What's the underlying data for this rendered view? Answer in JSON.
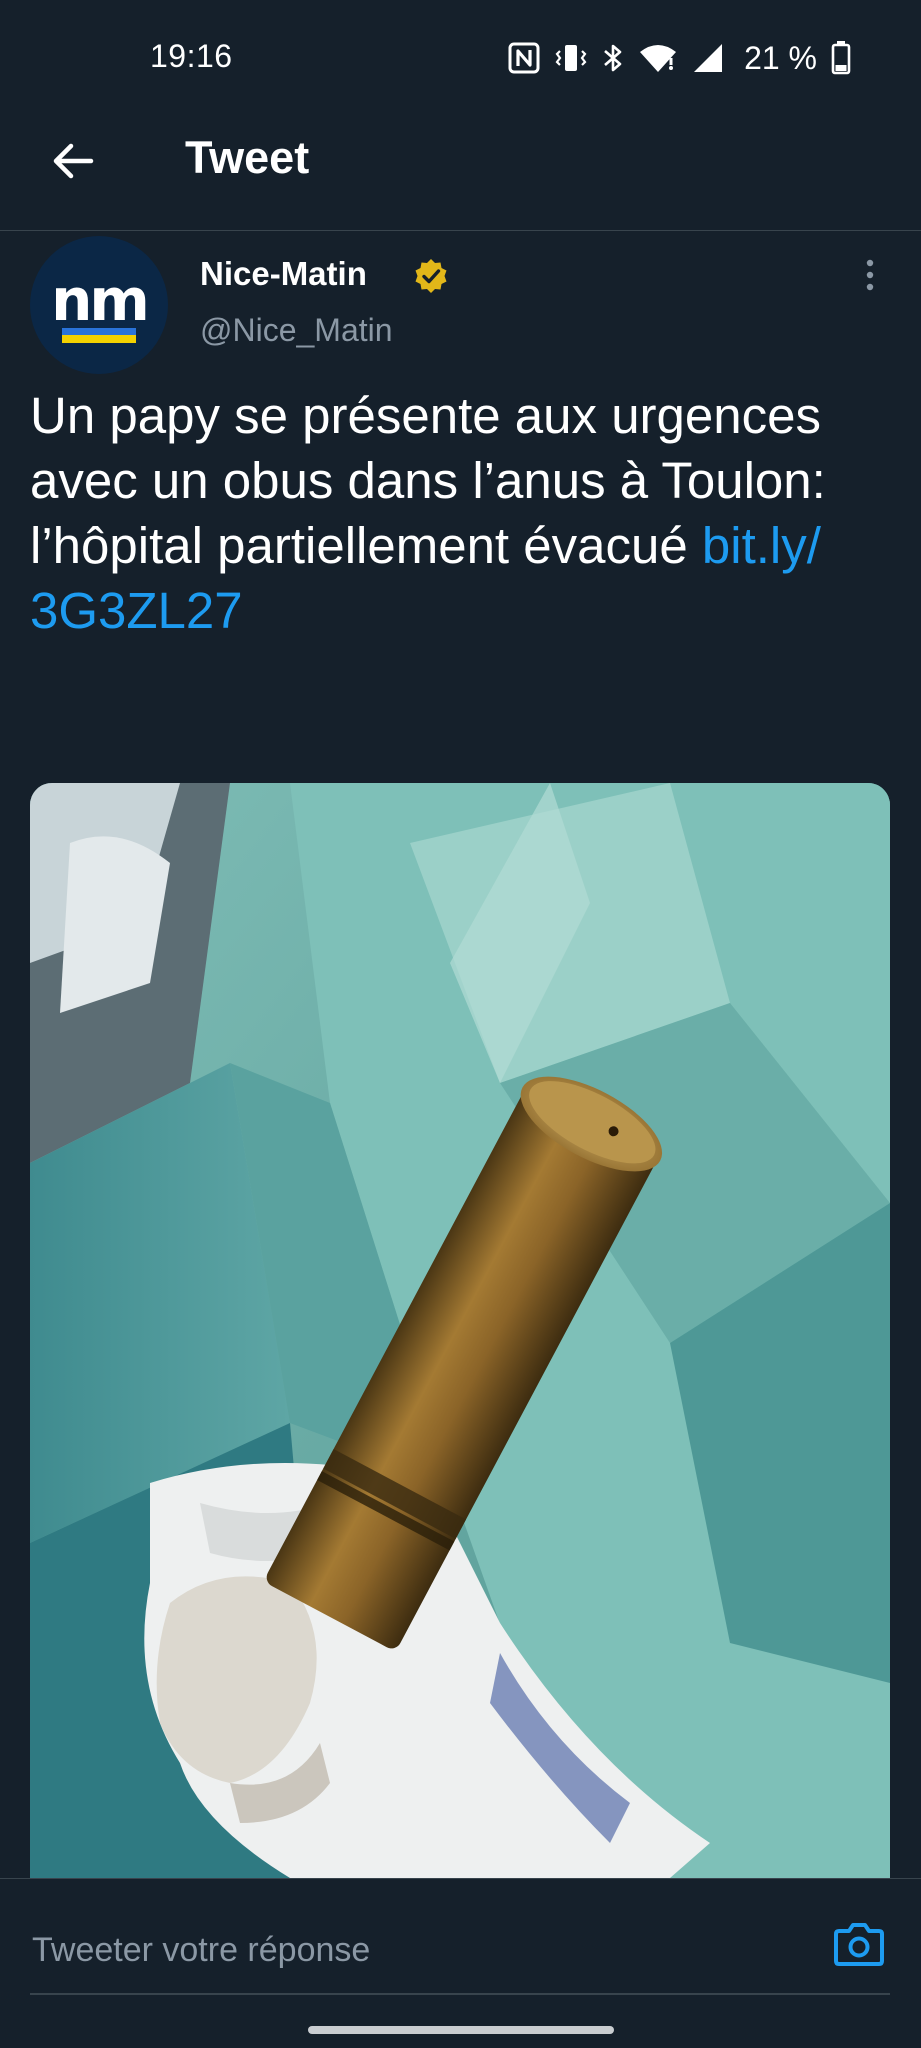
{
  "status_bar": {
    "time": "19:16",
    "battery": "21 %",
    "icons": [
      "nfc-icon",
      "vibrate-icon",
      "bluetooth-icon",
      "wifi-icon",
      "signal-icon",
      "battery-icon"
    ]
  },
  "header": {
    "title": "Tweet",
    "back_icon": "arrow-left-icon"
  },
  "tweet": {
    "author": {
      "avatar_text": "nm",
      "name": "Nice-Matin",
      "handle": "@Nice_Matin",
      "verified_color": "#e2b719"
    },
    "text": "Un papy se présente aux urgences avec un obus dans l’anus à Toulon: l’hôpital partiellement évacué ",
    "link": "bit.ly/\n3G3ZL27",
    "media": {
      "type": "photo"
    }
  },
  "reply": {
    "placeholder": "Tweeter votre réponse",
    "camera_icon": "camera-icon"
  },
  "colors": {
    "background": "#15202b",
    "link": "#1d9bf0",
    "secondary_text": "#8b98a5",
    "divider": "#38444d"
  }
}
